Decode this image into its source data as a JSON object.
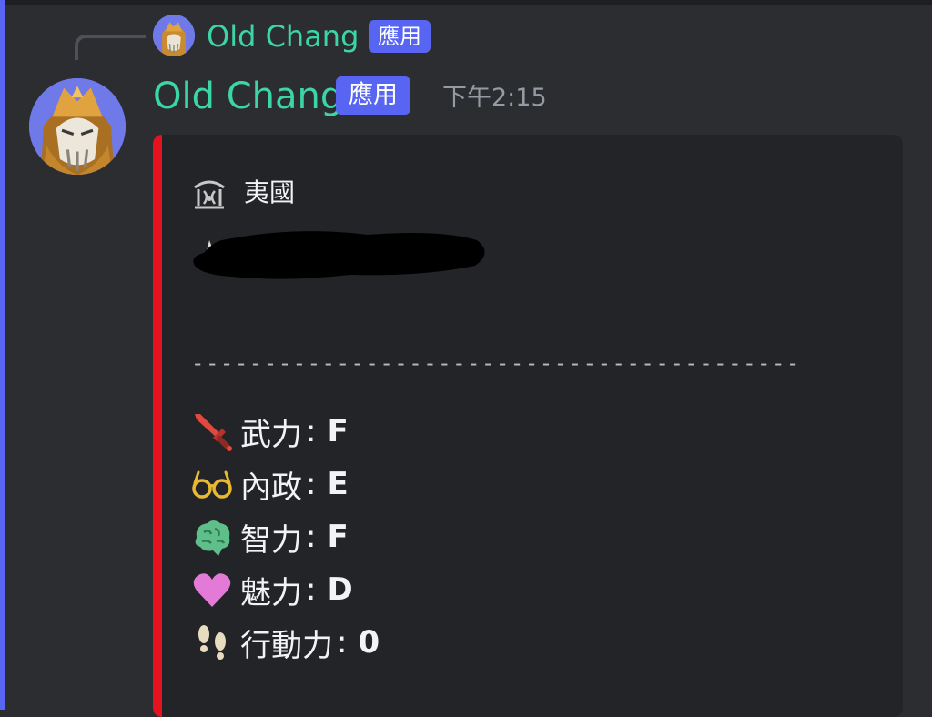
{
  "reply": {
    "author": "Old Chang",
    "tag": "應用"
  },
  "message": {
    "author": "Old Chang",
    "tag": "應用",
    "timestamp": "下午2:15"
  },
  "embed": {
    "accent_color": "#e5131f",
    "author_icon": "temple-icon",
    "author_name": "夷國",
    "divider": "------------------------------------------",
    "stats": [
      {
        "icon": "sword-icon",
        "label": "武力",
        "separator": ":",
        "value": "F"
      },
      {
        "icon": "glasses-icon",
        "label": "內政",
        "separator": ":",
        "value": "E"
      },
      {
        "icon": "brain-icon",
        "label": "智力",
        "separator": ":",
        "value": "F"
      },
      {
        "icon": "heart-icon",
        "label": "魅力",
        "separator": ":",
        "value": "D"
      },
      {
        "icon": "footprints-icon",
        "label": "行動力",
        "separator": ":",
        "value": "0"
      }
    ]
  },
  "colors": {
    "background": "#2b2d31",
    "username": "#3bd6a4",
    "app_tag": "#5865f2",
    "timestamp": "#949ba4"
  }
}
